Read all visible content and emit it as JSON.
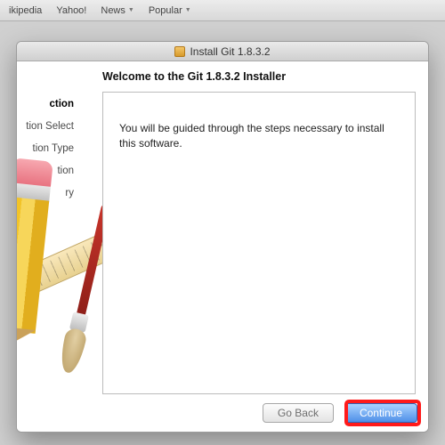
{
  "bookmarks": [
    "ikipedia",
    "Yahoo!",
    "News",
    "Popular"
  ],
  "bookmark_has_dropdown": [
    false,
    false,
    true,
    true
  ],
  "window": {
    "title": "Install Git 1.8.3.2"
  },
  "heading": "Welcome to the Git 1.8.3.2 Installer",
  "sidebar": {
    "items": [
      "ction",
      "tion Select",
      "tion Type",
      "tion",
      "ry"
    ],
    "active_index": 0
  },
  "panel": {
    "message": "You will be guided through the steps necessary to install this software."
  },
  "buttons": {
    "back": "Go Back",
    "continue": "Continue"
  }
}
